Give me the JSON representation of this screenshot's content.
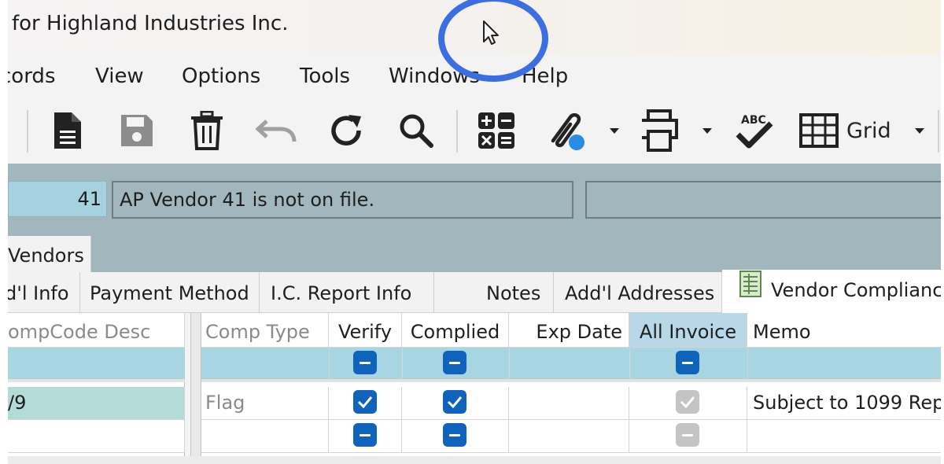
{
  "window": {
    "title": "for Highland Industries Inc."
  },
  "menu": {
    "items": [
      "cords",
      "View",
      "Options",
      "Tools",
      "Windows",
      "Help"
    ]
  },
  "toolbar": {
    "icons": [
      "new-document-icon",
      "save-icon",
      "delete-icon",
      "undo-icon",
      "refresh-icon",
      "search-icon",
      "calculator-icon",
      "attachment-icon",
      "print-icon",
      "spell-check-icon",
      "grid-icon"
    ],
    "grid_label": "Grid"
  },
  "vendor": {
    "number": "41",
    "message": "AP Vendor 41 is not on file."
  },
  "tabs": {
    "main": "Vendors"
  },
  "subtabs": [
    "d'l Info",
    "Payment Method",
    "I.C. Report Info",
    "Notes",
    "Add'l Addresses",
    "Vendor Complianc"
  ],
  "left_grid": {
    "header": "ompCode Desc",
    "rows": [
      "/9",
      ""
    ]
  },
  "right_grid": {
    "columns": [
      "Comp Type",
      "Verify",
      "Complied",
      "Exp Date",
      "All Invoice",
      "Memo"
    ],
    "rows": [
      {
        "comp_type": "Flag",
        "verify": "checked",
        "complied": "checked",
        "exp_date": "",
        "all_invoice": "checked-disabled",
        "memo": "Subject to 1099 Rep"
      },
      {
        "comp_type": "",
        "verify": "indeterminate",
        "complied": "indeterminate",
        "exp_date": "",
        "all_invoice": "indeterminate-disabled",
        "memo": ""
      }
    ]
  },
  "colors": {
    "accent": "#0f63bd",
    "strip": "#a2b7bd",
    "filter_row": "#a8d5e2",
    "cursor_ring": "#3b6ee0"
  }
}
